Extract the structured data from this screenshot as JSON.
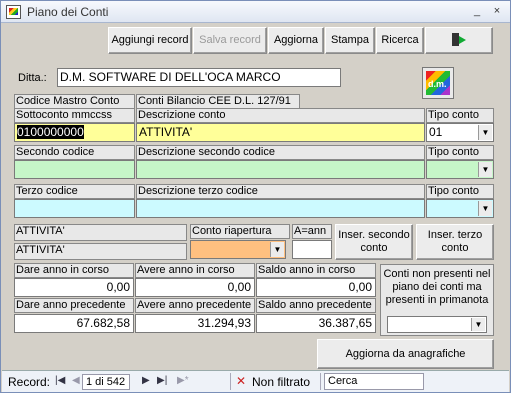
{
  "window": {
    "title": "Piano dei Conti"
  },
  "titlebar": {
    "minimize": "_",
    "close": "×"
  },
  "toolbar": {
    "add_record": "Aggiungi record",
    "save_record": "Salva record",
    "refresh": "Aggiorna",
    "print": "Stampa",
    "search": "Ricerca"
  },
  "ditta": {
    "label": "Ditta.:",
    "value": "D.M. SOFTWARE DI DELL'OCA MARCO"
  },
  "logo": {
    "text": "d.m."
  },
  "headers": {
    "codice_mastro_conto": "Codice Mastro Conto",
    "sottoconto": "Sottoconto mmccss",
    "conti_bilancio": "Conti Bilancio CEE D.L. 127/91",
    "descrizione_conto": "Descrizione conto",
    "tipo_conto": "Tipo conto",
    "secondo_codice": "Secondo codice",
    "descrizione_secondo": "Descrizione secondo codice",
    "tipo_conto_2": "Tipo conto",
    "terzo_codice": "Terzo codice",
    "descrizione_terzo": "Descrizione terzo codice",
    "tipo_conto_3": "Tipo conto"
  },
  "fields": {
    "codice": "0100000000",
    "descrizione": "ATTIVITA'",
    "tipo_conto": "01",
    "secondo_codice": "",
    "descrizione_secondo": "",
    "tipo_conto_2": "",
    "terzo_codice": "",
    "descrizione_terzo": "",
    "tipo_conto_3": ""
  },
  "riapertura": {
    "mastro_label": "ATTIVITA'",
    "conto_label": "ATTIVITA'",
    "conto_riapertura_label": "Conto riapertura",
    "conto_riapertura_value": "",
    "a_anno_label": "A=ann",
    "a_anno_value": ""
  },
  "buttons": {
    "inser_secondo": "Inser. secondo conto",
    "inser_terzo": "Inser. terzo conto",
    "aggiorna_anagrafiche": "Aggiorna da anagrafiche"
  },
  "saldi": {
    "dare_corso_label": "Dare anno in corso",
    "avere_corso_label": "Avere anno in corso",
    "saldo_corso_label": "Saldo anno in corso",
    "dare_corso": "0,00",
    "avere_corso": "0,00",
    "saldo_corso": "0,00",
    "dare_prec_label": "Dare anno precedente",
    "avere_prec_label": "Avere anno precedente",
    "saldo_prec_label": "Saldo anno precedente",
    "dare_prec": "67.682,58",
    "avere_prec": "31.294,93",
    "saldo_prec": "36.387,65"
  },
  "conti_non_presenti": {
    "label": "Conti non presenti nel piano dei conti ma presenti in primanota",
    "value": ""
  },
  "statusbar": {
    "record_label": "Record:",
    "record_position": "1 di 542",
    "filter_label": "Non filtrato",
    "search_placeholder": "Cerca"
  }
}
